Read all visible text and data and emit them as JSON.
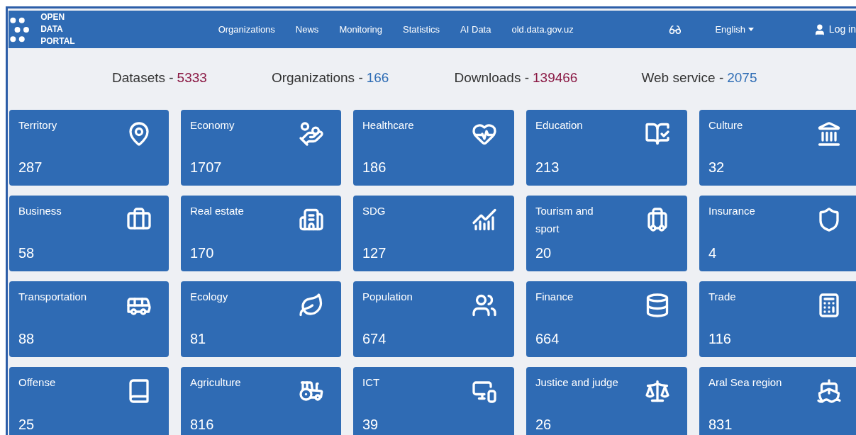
{
  "header": {
    "logo_lines": [
      "OPEN",
      "DATA",
      "PORTAL"
    ],
    "nav": [
      "Organizations",
      "News",
      "Monitoring",
      "Statistics",
      "AI Data",
      "old.data.gov.uz"
    ],
    "language": "English",
    "login": "Log in"
  },
  "stats": [
    {
      "label": "Datasets -",
      "value": "5333",
      "color": "#8b1a45"
    },
    {
      "label": "Organizations -",
      "value": "166",
      "color": "#2f6db5"
    },
    {
      "label": "Downloads -",
      "value": "139466",
      "color": "#8b1a45"
    },
    {
      "label": "Web service -",
      "value": "2075",
      "color": "#2f6db5"
    }
  ],
  "categories": [
    {
      "title": "Territory",
      "count": "287"
    },
    {
      "title": "Economy",
      "count": "1707"
    },
    {
      "title": "Healthcare",
      "count": "186"
    },
    {
      "title": "Education",
      "count": "213"
    },
    {
      "title": "Culture",
      "count": "32"
    },
    {
      "title": "Business",
      "count": "58"
    },
    {
      "title": "Real estate",
      "count": "170"
    },
    {
      "title": "SDG",
      "count": "127"
    },
    {
      "title": "Tourism and sport",
      "count": "20"
    },
    {
      "title": "Insurance",
      "count": "4"
    },
    {
      "title": "Transportation",
      "count": "88"
    },
    {
      "title": "Ecology",
      "count": "81"
    },
    {
      "title": "Population",
      "count": "674"
    },
    {
      "title": "Finance",
      "count": "664"
    },
    {
      "title": "Trade",
      "count": "116"
    },
    {
      "title": "Offense",
      "count": "25"
    },
    {
      "title": "Agriculture",
      "count": "816"
    },
    {
      "title": "ICT",
      "count": "39"
    },
    {
      "title": "Justice and judge",
      "count": "26"
    },
    {
      "title": "Aral Sea region",
      "count": "831"
    }
  ]
}
